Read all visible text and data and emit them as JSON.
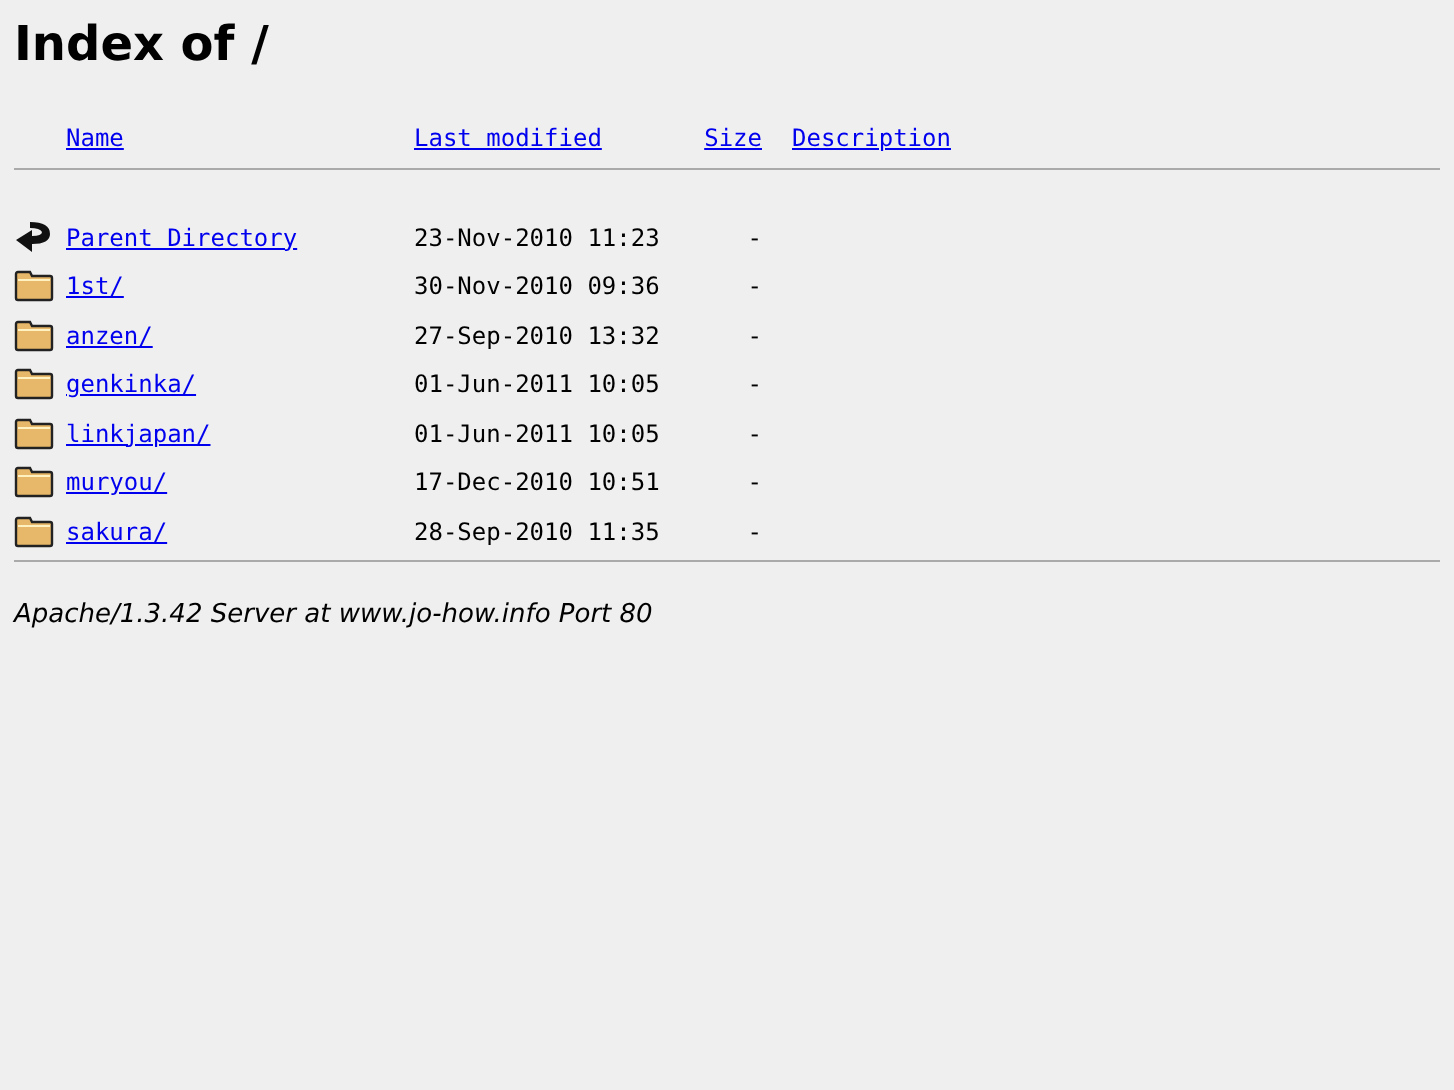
{
  "title": "Index of /",
  "columns": [
    "Name",
    "Last modified",
    "Size",
    "Description"
  ],
  "rows": [
    {
      "kind": "parent",
      "name": "Parent Directory",
      "modified": "23-Nov-2010 11:23",
      "size": "-"
    },
    {
      "kind": "folder",
      "name": "1st/",
      "modified": "30-Nov-2010 09:36",
      "size": "-"
    },
    {
      "kind": "folder",
      "name": "anzen/",
      "modified": "27-Sep-2010 13:32",
      "size": "-"
    },
    {
      "kind": "folder",
      "name": "genkinka/",
      "modified": "01-Jun-2011 10:05",
      "size": "-"
    },
    {
      "kind": "folder",
      "name": "linkjapan/",
      "modified": "01-Jun-2011 10:05",
      "size": "-"
    },
    {
      "kind": "folder",
      "name": "muryou/",
      "modified": "17-Dec-2010 10:51",
      "size": "-"
    },
    {
      "kind": "folder",
      "name": "sakura/",
      "modified": "28-Sep-2010 11:35",
      "size": "-"
    }
  ],
  "footer": "Apache/1.3.42 Server at www.jo-how.info Port 80"
}
